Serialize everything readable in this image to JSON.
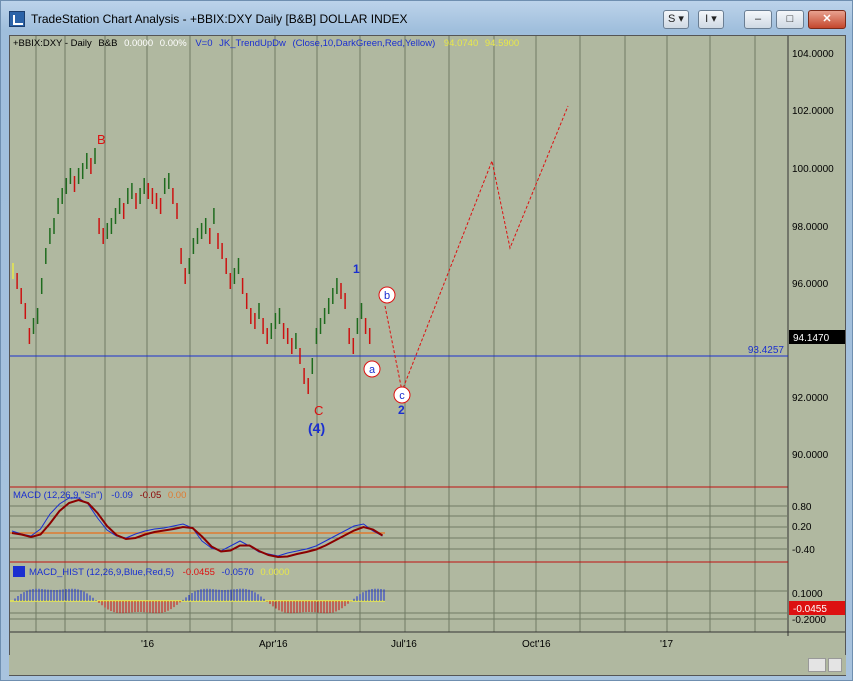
{
  "window": {
    "title": "TradeStation Chart Analysis - +BBIX:DXY Daily [B&B] DOLLAR INDEX",
    "buttons": {
      "settings": "S",
      "info": "I",
      "minimize": "–",
      "maximize": "□",
      "close": "✕"
    }
  },
  "price_panel": {
    "header": {
      "symbol": "+BBIX:DXY - Daily",
      "bb": "B&B",
      "change": "0.0000",
      "pct": "0.00%",
      "volume": "V=0",
      "indicator": "JK_TrendUpDw",
      "params": "(Close,10,DarkGreen,Red,Yellow)",
      "val1": "94.0740",
      "val2": "94.5900"
    },
    "y_ticks": [
      "104.0000",
      "102.0000",
      "100.0000",
      "98.0000",
      "96.0000",
      "92.0000",
      "90.0000"
    ],
    "last_price": "94.1470",
    "support_line_label": "93.4257",
    "wave_labels": {
      "B": "B",
      "C": "C",
      "wave4": "(4)",
      "w1": "1",
      "w2": "2",
      "a": "a",
      "b": "b",
      "c": "c"
    }
  },
  "macd_panel": {
    "title": "MACD (12,26,9,\"Sn\")",
    "v1": "-0.09",
    "v2": "-0.05",
    "v3": "0.00",
    "y_ticks": [
      "0.80",
      "0.20",
      "-0.40"
    ]
  },
  "hist_panel": {
    "title": "MACD_HIST (12,26,9,Blue,Red,5)",
    "v1": "-0.0455",
    "v2": "-0.0570",
    "v3": "0.0000",
    "y_ticks": [
      "0.1000",
      "-0.2000"
    ],
    "last_value": "-0.0455"
  },
  "x_axis": {
    "labels": [
      "'16",
      "Apr'16",
      "Jul'16",
      "Oct'16",
      "'17"
    ]
  },
  "colors": {
    "background": "#b0b8a0",
    "up": "#1e6b1e",
    "down": "#cc1111",
    "neutral": "#e8e84a",
    "wave_blue": "#1a2fd0",
    "wave_red": "#d11",
    "macd_blue": "#1a2fd0",
    "macd_signal": "#8b0000",
    "zero_line": "#e07a30"
  }
}
